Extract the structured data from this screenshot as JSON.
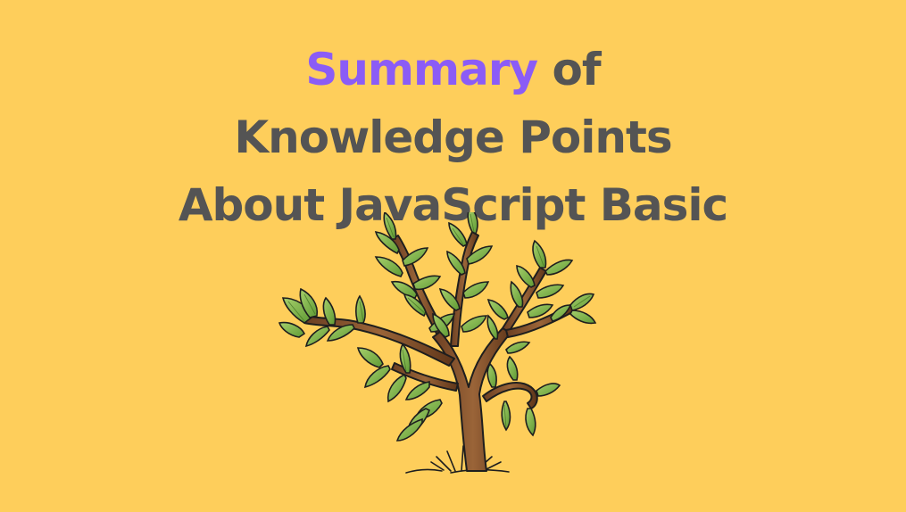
{
  "title": {
    "line1_highlight": "Summary",
    "line1_rest": "of",
    "line2": "Knowledge Points",
    "line3": "About JavaScript Basic"
  },
  "illustration": {
    "icon": "tree-icon"
  },
  "colors": {
    "background": "#FECE5B",
    "text": "#545454",
    "accent": "#8B5CF6",
    "leaf": "#7DB24A",
    "leaf_dark": "#4E8A2A",
    "trunk": "#7A4A2A",
    "outline": "#1E1E1E"
  }
}
